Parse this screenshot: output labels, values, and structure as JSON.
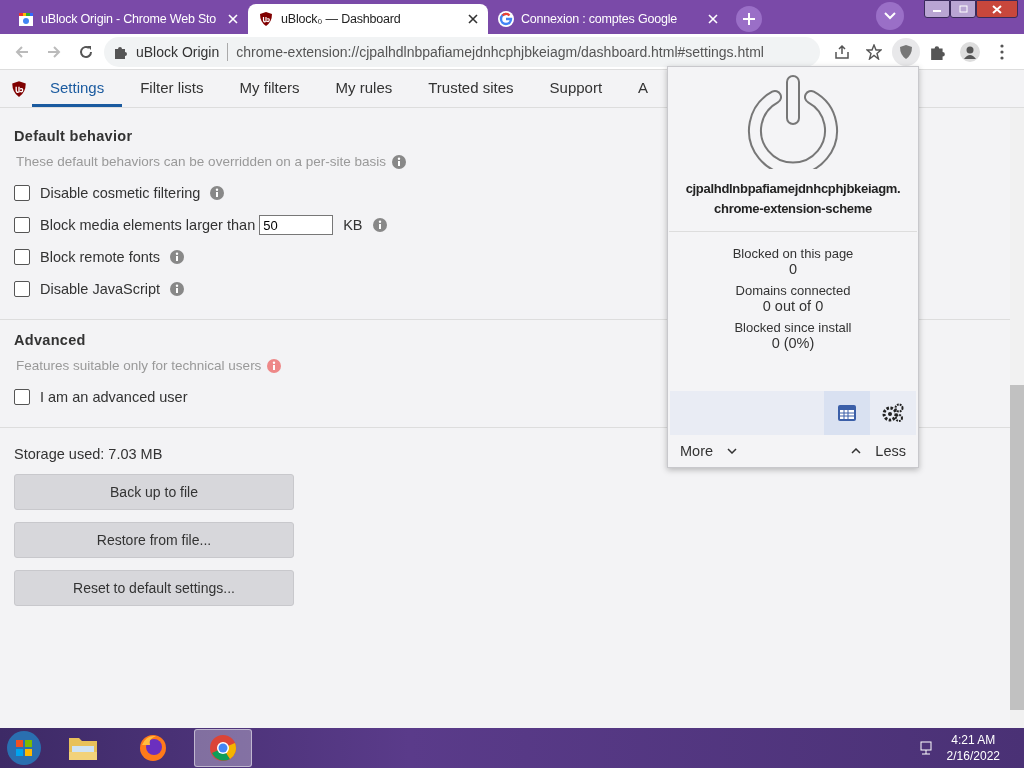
{
  "browser": {
    "tabs": [
      {
        "title": "uBlock Origin - Chrome Web Sto",
        "kind": "store",
        "selected": false
      },
      {
        "title": "uBlock₀ — Dashboard",
        "kind": "ublock",
        "selected": true
      },
      {
        "title": "Connexion : comptes Google",
        "kind": "google",
        "selected": false
      }
    ],
    "address": {
      "site": "uBlock Origin",
      "url": "chrome-extension://cjpalhdlnbpafiamejdnhcphjbkeiagm/dashboard.html#settings.html"
    }
  },
  "nav": {
    "tabs": [
      {
        "label": "Settings",
        "selected": true
      },
      {
        "label": "Filter lists",
        "selected": false
      },
      {
        "label": "My filters",
        "selected": false
      },
      {
        "label": "My rules",
        "selected": false
      },
      {
        "label": "Trusted sites",
        "selected": false
      },
      {
        "label": "Support",
        "selected": false
      },
      {
        "label": "A",
        "selected": false
      }
    ]
  },
  "sections": [
    {
      "title": "Default behavior",
      "hint": "These default behaviors can be overridden on a per-site basis",
      "alert": false,
      "options": [
        {
          "kind": "checkbox",
          "label": "Disable cosmetic filtering",
          "checked": false
        },
        {
          "kind": "size",
          "label": "Block media elements larger than",
          "value": "50",
          "unit": "KB",
          "checked": false
        },
        {
          "kind": "checkbox",
          "label": "Block remote fonts",
          "checked": false
        },
        {
          "kind": "checkbox",
          "label": "Disable JavaScript",
          "checked": false
        }
      ]
    },
    {
      "title": "Advanced",
      "hint": "Features suitable only for technical users",
      "alert": true,
      "options": [
        {
          "kind": "plain",
          "label": "I am an advanced user",
          "checked": false
        }
      ]
    }
  ],
  "storage": "Storage used: 7.03 MB",
  "buttons": [
    "Back up to file",
    "Restore from file...",
    "Reset to default settings..."
  ],
  "popup": {
    "hostname": [
      "cjpalhdlnbpafiamejdnhcphjbkeiagm.",
      "chrome-extension-scheme"
    ],
    "stats": [
      {
        "label": "Blocked on this page",
        "value": "0"
      },
      {
        "label": "Domains connected",
        "value": "0 out of 0"
      },
      {
        "label": "Blocked since install",
        "value": "0 (0%)"
      }
    ],
    "tools": [
      {
        "kind": "dashboard",
        "selected": true
      },
      {
        "kind": "settings",
        "selected": false
      }
    ],
    "more": "More",
    "less": "Less"
  },
  "taskbar": {
    "apps": [
      {
        "kind": "explorer",
        "selected": false
      },
      {
        "kind": "firefox",
        "selected": false
      },
      {
        "kind": "chrome",
        "selected": true
      }
    ],
    "time": "4:21 AM",
    "date": "2/16/2022"
  }
}
